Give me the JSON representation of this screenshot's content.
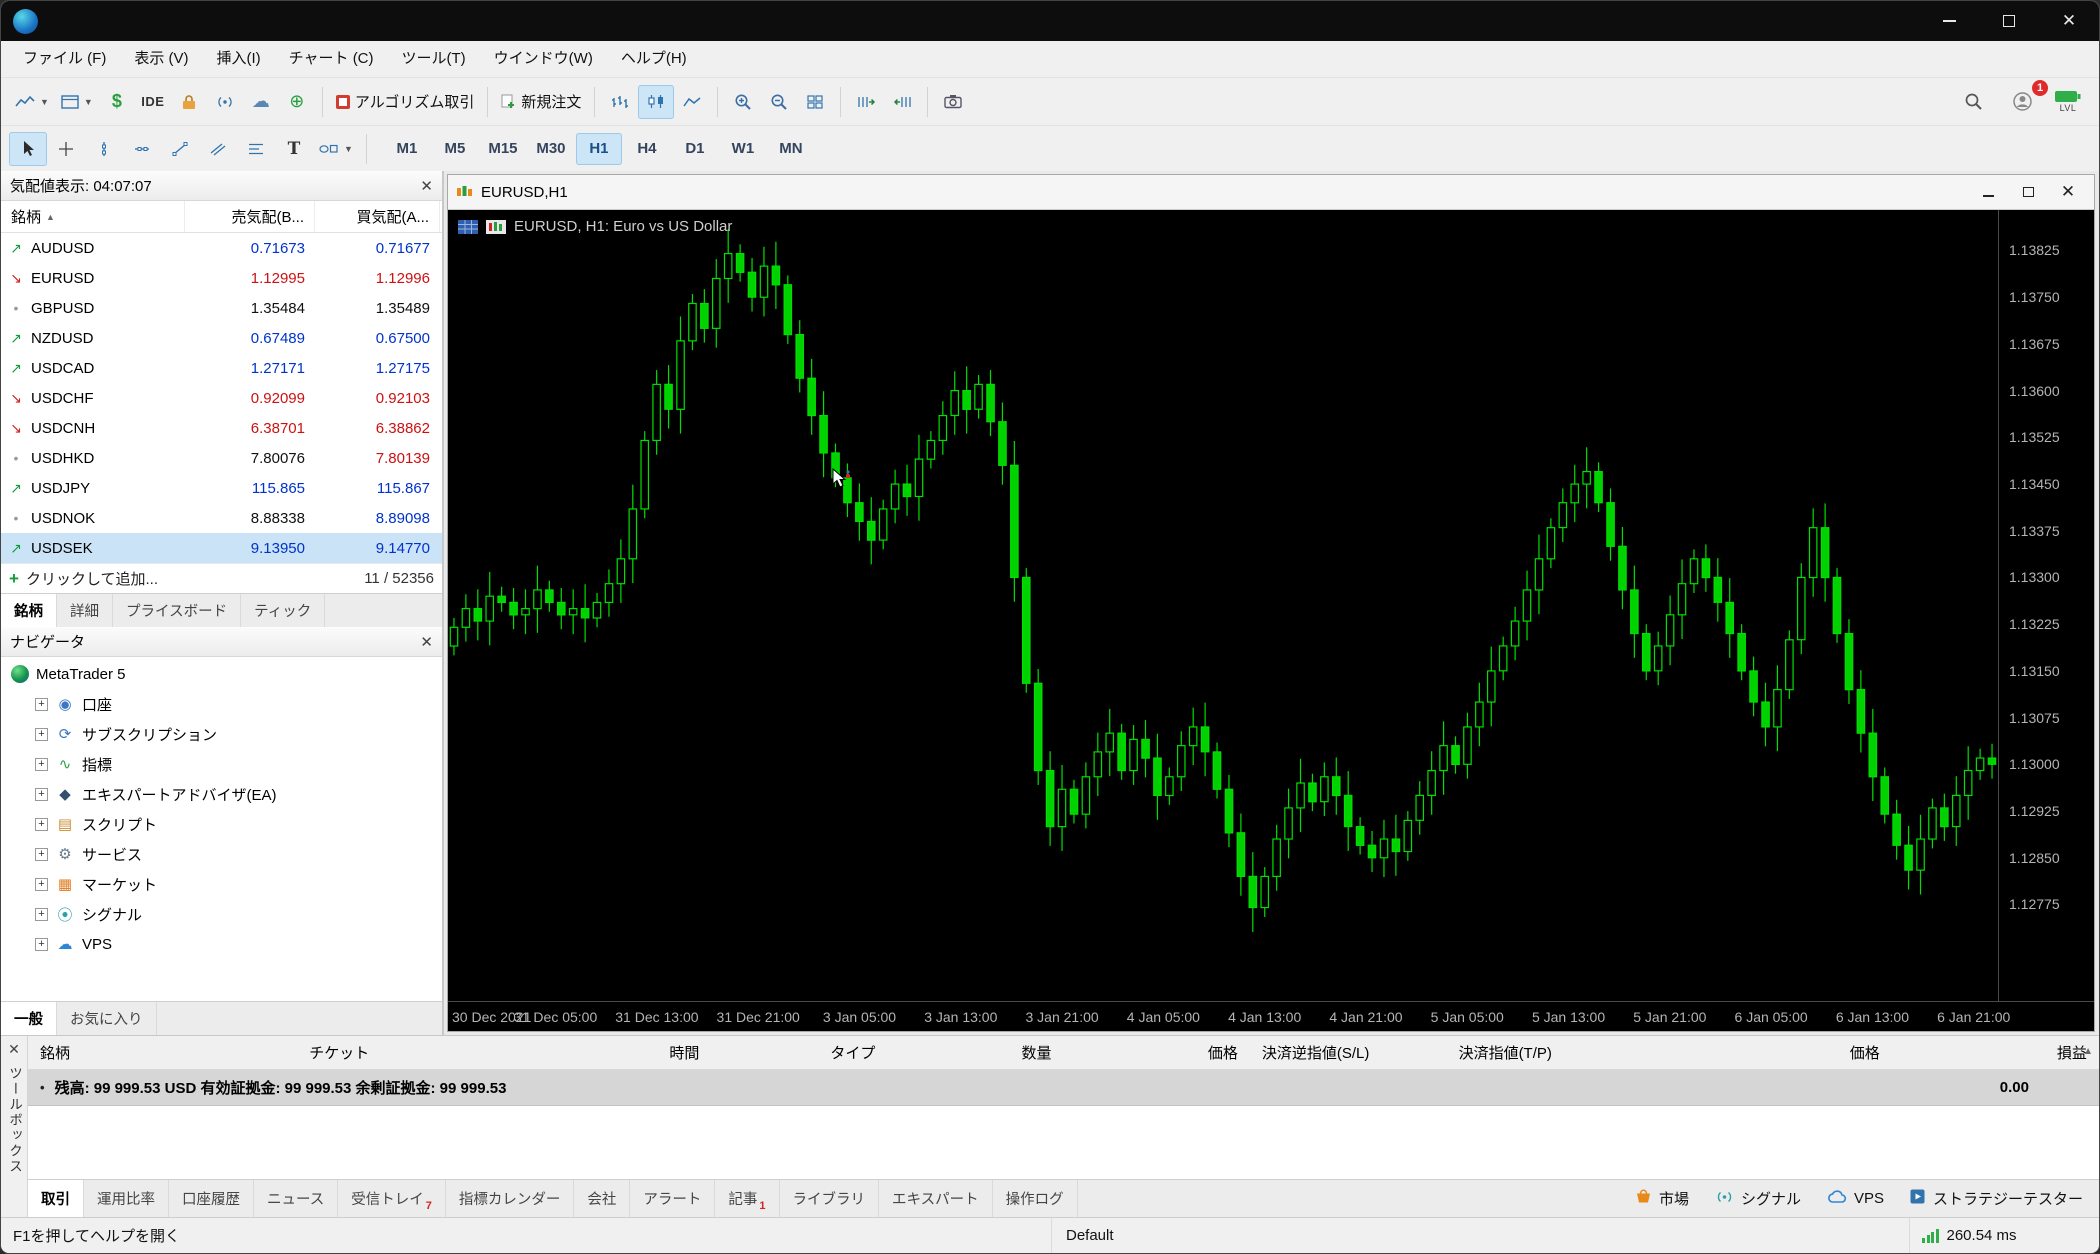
{
  "menu": {
    "items": [
      "ファイル (F)",
      "表示 (V)",
      "挿入(I)",
      "チャート (C)",
      "ツール(T)",
      "ウインドウ(W)",
      "ヘルプ(H)"
    ]
  },
  "toolbar": {
    "ide_label": "IDE",
    "algo_label": "アルゴリズム取引",
    "new_order_label": "新規注文",
    "badge_count": "1",
    "lvl_label": "LVL"
  },
  "timeframes": {
    "items": [
      "M1",
      "M5",
      "M15",
      "M30",
      "H1",
      "H4",
      "D1",
      "W1",
      "MN"
    ],
    "active": "H1"
  },
  "market_watch": {
    "title": "気配値表示: 04:07:07",
    "columns": [
      "銘柄",
      "売気配(B...",
      "買気配(A..."
    ],
    "rows": [
      {
        "symbol": "AUDUSD",
        "bid": "0.71673",
        "ask": "0.71677",
        "trend": "up",
        "bid_color": "blue",
        "ask_color": "blue",
        "selected": false
      },
      {
        "symbol": "EURUSD",
        "bid": "1.12995",
        "ask": "1.12996",
        "trend": "down",
        "bid_color": "red",
        "ask_color": "red",
        "selected": false
      },
      {
        "symbol": "GBPUSD",
        "bid": "1.35484",
        "ask": "1.35489",
        "trend": "flat",
        "bid_color": "black",
        "ask_color": "black",
        "selected": false
      },
      {
        "symbol": "NZDUSD",
        "bid": "0.67489",
        "ask": "0.67500",
        "trend": "up",
        "bid_color": "blue",
        "ask_color": "blue",
        "selected": false
      },
      {
        "symbol": "USDCAD",
        "bid": "1.27171",
        "ask": "1.27175",
        "trend": "up",
        "bid_color": "blue",
        "ask_color": "blue",
        "selected": false
      },
      {
        "symbol": "USDCHF",
        "bid": "0.92099",
        "ask": "0.92103",
        "trend": "down",
        "bid_color": "red",
        "ask_color": "red",
        "selected": false
      },
      {
        "symbol": "USDCNH",
        "bid": "6.38701",
        "ask": "6.38862",
        "trend": "down",
        "bid_color": "red",
        "ask_color": "red",
        "selected": false
      },
      {
        "symbol": "USDHKD",
        "bid": "7.80076",
        "ask": "7.80139",
        "trend": "flat",
        "bid_color": "black",
        "ask_color": "red",
        "selected": false
      },
      {
        "symbol": "USDJPY",
        "bid": "115.865",
        "ask": "115.867",
        "trend": "up",
        "bid_color": "blue",
        "ask_color": "blue",
        "selected": false
      },
      {
        "symbol": "USDNOK",
        "bid": "8.88338",
        "ask": "8.89098",
        "trend": "flat",
        "bid_color": "black",
        "ask_color": "blue",
        "selected": false
      },
      {
        "symbol": "USDSEK",
        "bid": "9.13950",
        "ask": "9.14770",
        "trend": "up",
        "bid_color": "blue",
        "ask_color": "blue",
        "selected": true
      }
    ],
    "add_row_label": "クリックして追加...",
    "count_label": "11 / 52356",
    "tabs": [
      "銘柄",
      "詳細",
      "プライスボード",
      "ティック"
    ],
    "active_tab": "銘柄"
  },
  "navigator": {
    "title": "ナビゲータ",
    "root_label": "MetaTrader 5",
    "items": [
      "口座",
      "サブスクリプション",
      "指標",
      "エキスパートアドバイザ(EA)",
      "スクリプト",
      "サービス",
      "マーケット",
      "シグナル",
      "VPS"
    ],
    "tabs": [
      "一般",
      "お気に入り"
    ],
    "active_tab": "一般"
  },
  "chart": {
    "window_title": "EURUSD,H1",
    "info_label": "EURUSD, H1: Euro vs US Dollar",
    "chart_data": {
      "type": "candlestick",
      "symbol": "EURUSD",
      "timeframe": "H1",
      "background": "#000000",
      "up_color": "#000000",
      "down_color": "#00d200",
      "outline_color": "#00e000",
      "ylim": [
        1.1262,
        1.1389
      ],
      "bars_per_tick": 8,
      "open_first": 1.1319,
      "closes": [
        1.1322,
        1.1325,
        1.1323,
        1.1327,
        1.1326,
        1.1324,
        1.1325,
        1.1328,
        1.1326,
        1.1324,
        1.1325,
        1.13235,
        1.1326,
        1.1329,
        1.1333,
        1.1341,
        1.1352,
        1.1361,
        1.1357,
        1.1368,
        1.1374,
        1.137,
        1.1378,
        1.1382,
        1.1379,
        1.1375,
        1.138,
        1.1377,
        1.1369,
        1.1362,
        1.1356,
        1.135,
        1.1346,
        1.1342,
        1.1339,
        1.1336,
        1.1341,
        1.1345,
        1.1343,
        1.1349,
        1.1352,
        1.1356,
        1.136,
        1.1357,
        1.1361,
        1.1355,
        1.1348,
        1.133,
        1.1313,
        1.1299,
        1.129,
        1.1296,
        1.1292,
        1.1298,
        1.1302,
        1.1305,
        1.1299,
        1.1304,
        1.1301,
        1.1295,
        1.1298,
        1.1303,
        1.1306,
        1.1302,
        1.1296,
        1.1289,
        1.1282,
        1.1277,
        1.1282,
        1.1288,
        1.1293,
        1.1297,
        1.1294,
        1.1298,
        1.1295,
        1.129,
        1.1287,
        1.1285,
        1.1288,
        1.1286,
        1.1291,
        1.1295,
        1.1299,
        1.1303,
        1.13,
        1.1306,
        1.131,
        1.1315,
        1.1319,
        1.1323,
        1.1328,
        1.1333,
        1.1338,
        1.1342,
        1.1345,
        1.1347,
        1.1342,
        1.1335,
        1.1328,
        1.1321,
        1.1315,
        1.1319,
        1.1324,
        1.1329,
        1.1333,
        1.133,
        1.1326,
        1.1321,
        1.1315,
        1.131,
        1.1306,
        1.1312,
        1.132,
        1.133,
        1.1338,
        1.133,
        1.1321,
        1.1312,
        1.1305,
        1.1298,
        1.1292,
        1.1287,
        1.1283,
        1.1288,
        1.1293,
        1.129,
        1.1295,
        1.1299,
        1.1301,
        1.13
      ],
      "y_ticks": [
        "1.13825",
        "1.13750",
        "1.13675",
        "1.13600",
        "1.13525",
        "1.13450",
        "1.13375",
        "1.13300",
        "1.13225",
        "1.13150",
        "1.13075",
        "1.13000",
        "1.12925",
        "1.12850",
        "1.12775"
      ],
      "x_ticks": [
        "30 Dec 2021",
        "31 Dec 05:00",
        "31 Dec 13:00",
        "31 Dec 21:00",
        "3 Jan 05:00",
        "3 Jan 13:00",
        "3 Jan 21:00",
        "4 Jan 05:00",
        "4 Jan 13:00",
        "4 Jan 21:00",
        "5 Jan 05:00",
        "5 Jan 13:00",
        "5 Jan 21:00",
        "6 Jan 05:00",
        "6 Jan 13:00",
        "6 Jan 21:00"
      ]
    }
  },
  "toolbox": {
    "vertical_label": "ツールボックス",
    "columns": [
      "銘柄",
      "チケット",
      "時間",
      "タイプ",
      "数量",
      "価格",
      "決済逆指値(S/L)",
      "決済指値(T/P)",
      "価格",
      "損益"
    ],
    "balance_text": "残高: 99 999.53 USD  有効証拠金: 99 999.53  余剰証拠金: 99 999.53",
    "balance_profit": "0.00",
    "tabs": [
      {
        "label": "取引",
        "active": true
      },
      {
        "label": "運用比率"
      },
      {
        "label": "口座履歴"
      },
      {
        "label": "ニュース"
      },
      {
        "label": "受信トレイ",
        "badge": "7"
      },
      {
        "label": "指標カレンダー"
      },
      {
        "label": "会社"
      },
      {
        "label": "アラート"
      },
      {
        "label": "記事",
        "badge": "1"
      },
      {
        "label": "ライブラリ"
      },
      {
        "label": "エキスパート"
      },
      {
        "label": "操作ログ"
      }
    ],
    "right_buttons": [
      "市場",
      "シグナル",
      "VPS",
      "ストラテジーテスター"
    ]
  },
  "status_bar": {
    "help": "F1を押してヘルプを開く",
    "profile": "Default",
    "latency": "260.54 ms"
  }
}
